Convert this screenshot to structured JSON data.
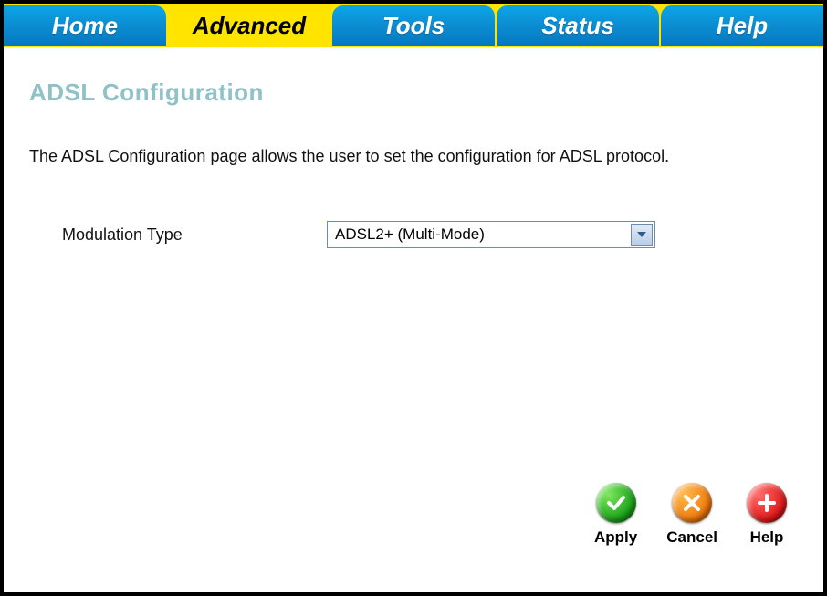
{
  "tabs": {
    "items": [
      {
        "label": "Home"
      },
      {
        "label": "Advanced"
      },
      {
        "label": "Tools"
      },
      {
        "label": "Status"
      },
      {
        "label": "Help"
      }
    ],
    "active_index": 1
  },
  "page": {
    "title": "ADSL Configuration",
    "description": "The ADSL Configuration page allows the user to set the configuration for ADSL protocol."
  },
  "form": {
    "modulation": {
      "label": "Modulation Type",
      "value": "ADSL2+ (Multi-Mode)"
    }
  },
  "actions": {
    "apply": {
      "label": "Apply"
    },
    "cancel": {
      "label": "Cancel"
    },
    "help": {
      "label": "Help"
    }
  }
}
